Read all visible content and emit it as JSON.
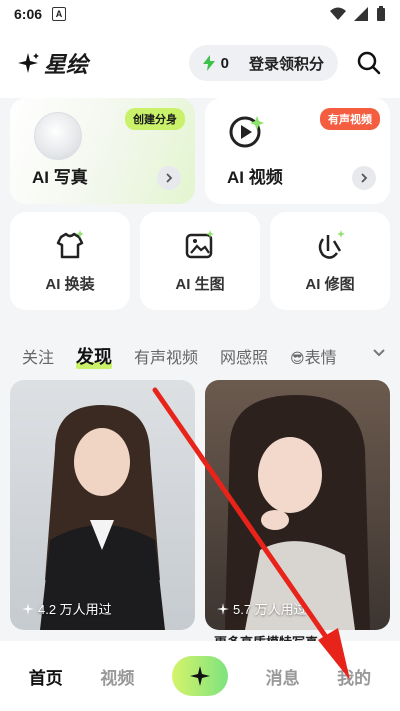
{
  "status_bar": {
    "time": "6:06",
    "notif_letter": "A"
  },
  "header": {
    "app_name": "星绘",
    "points": "0",
    "login_label": "登录领积分"
  },
  "top_cards": [
    {
      "label": "AI 写真",
      "badge": "创建分身"
    },
    {
      "label": "AI 视频",
      "badge": "有声视频"
    }
  ],
  "small_cards": [
    {
      "label": "AI 换装"
    },
    {
      "label": "AI 生图"
    },
    {
      "label": "AI 修图"
    }
  ],
  "tabs": [
    "关注",
    "发现",
    "有声视频",
    "网感照",
    "表情"
  ],
  "tab_emoji": "😎",
  "feed": [
    {
      "stat": "4.2 万人用过"
    },
    {
      "stat": "5.7 万人用过"
    }
  ],
  "feed_caption": "更多高质模特写真",
  "bottom_nav": {
    "home": "首页",
    "video": "视频",
    "messages": "消息",
    "mine": "我的"
  },
  "colors": {
    "accent": "#c9f26a",
    "badge_red": "#f45d3f",
    "arrow_red": "#e8231a"
  }
}
